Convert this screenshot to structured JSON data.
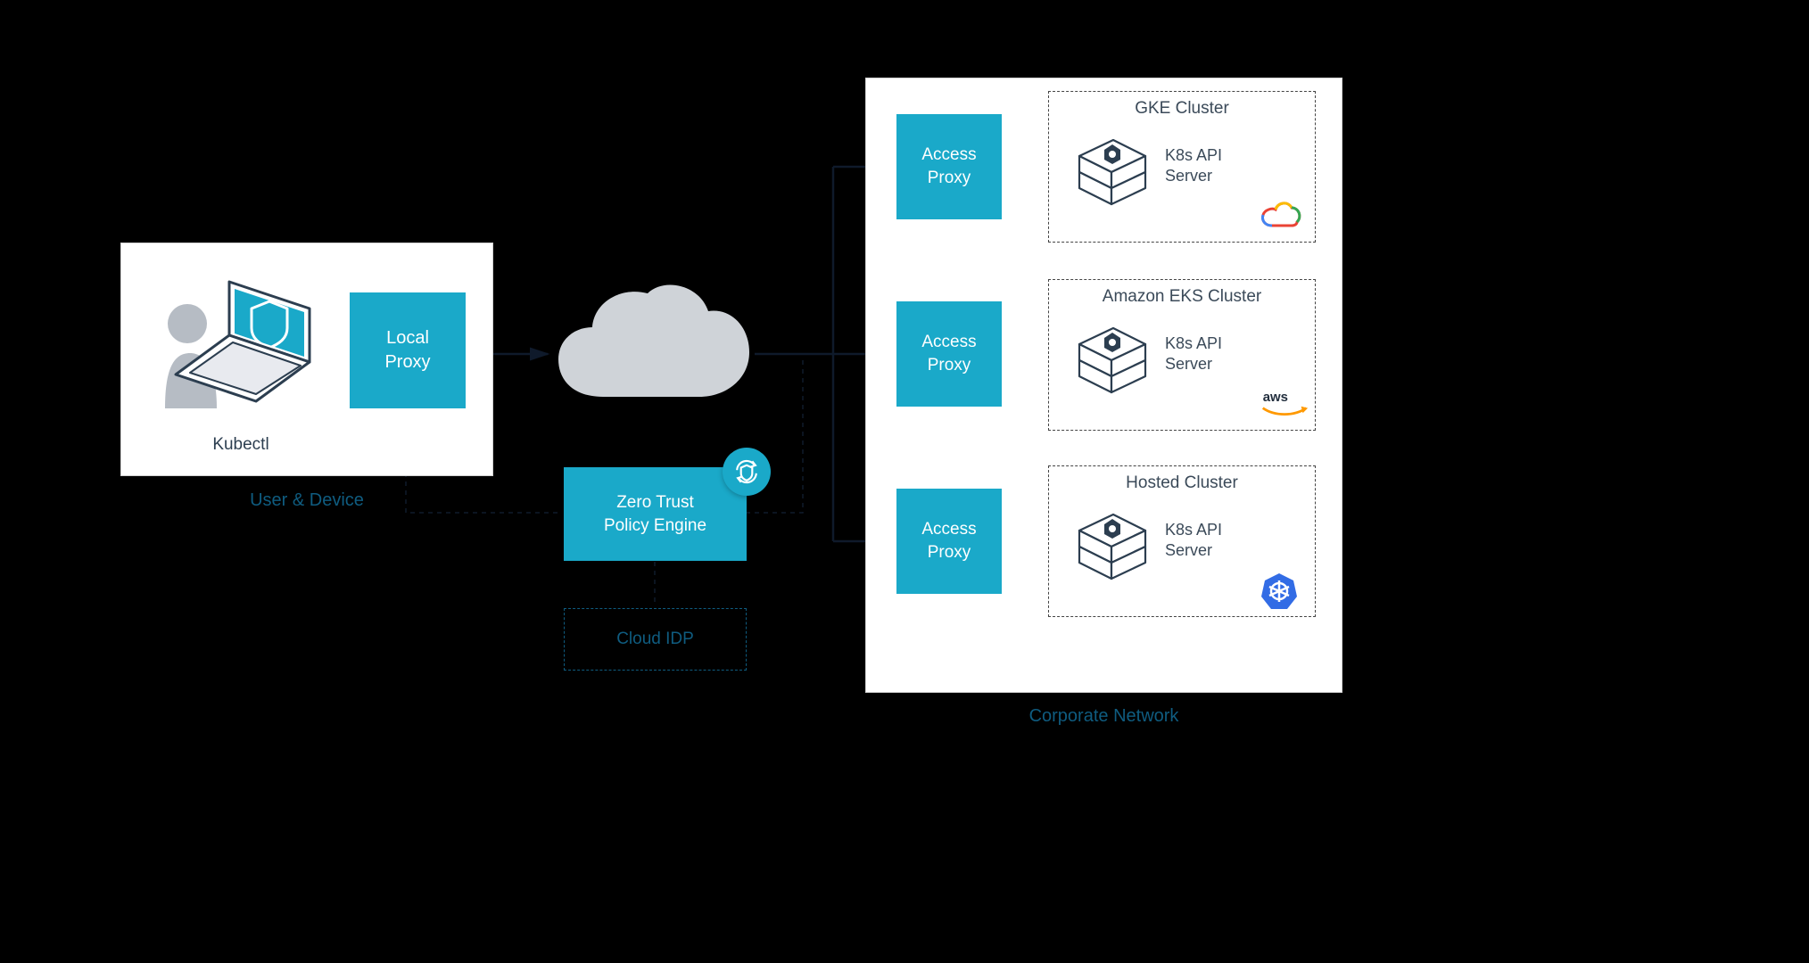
{
  "user_device": {
    "label": "User & Device",
    "kubectl_label": "Kubectl"
  },
  "local_proxy": {
    "line1": "Local",
    "line2": "Proxy"
  },
  "zero_trust": {
    "line1": "Zero Trust",
    "line2": "Policy Engine"
  },
  "cloud_idp": {
    "label": "Cloud IDP"
  },
  "corporate_network": {
    "label": "Corporate Network",
    "access_proxy_label": "Access",
    "access_proxy_label2": "Proxy",
    "clusters": [
      {
        "title": "GKE Cluster",
        "api_label1": "K8s API",
        "api_label2": "Server",
        "provider": "gcp"
      },
      {
        "title": "Amazon EKS Cluster",
        "api_label1": "K8s API",
        "api_label2": "Server",
        "provider": "aws"
      },
      {
        "title": "Hosted Cluster",
        "api_label1": "K8s API",
        "api_label2": "Server",
        "provider": "k8s"
      }
    ]
  },
  "colors": {
    "teal": "#1aa9c9",
    "panel_border": "#d0d0d0",
    "dark_navy": "#0f1a2b",
    "muted_navy": "#0f5c80",
    "text": "#3b4a59"
  }
}
